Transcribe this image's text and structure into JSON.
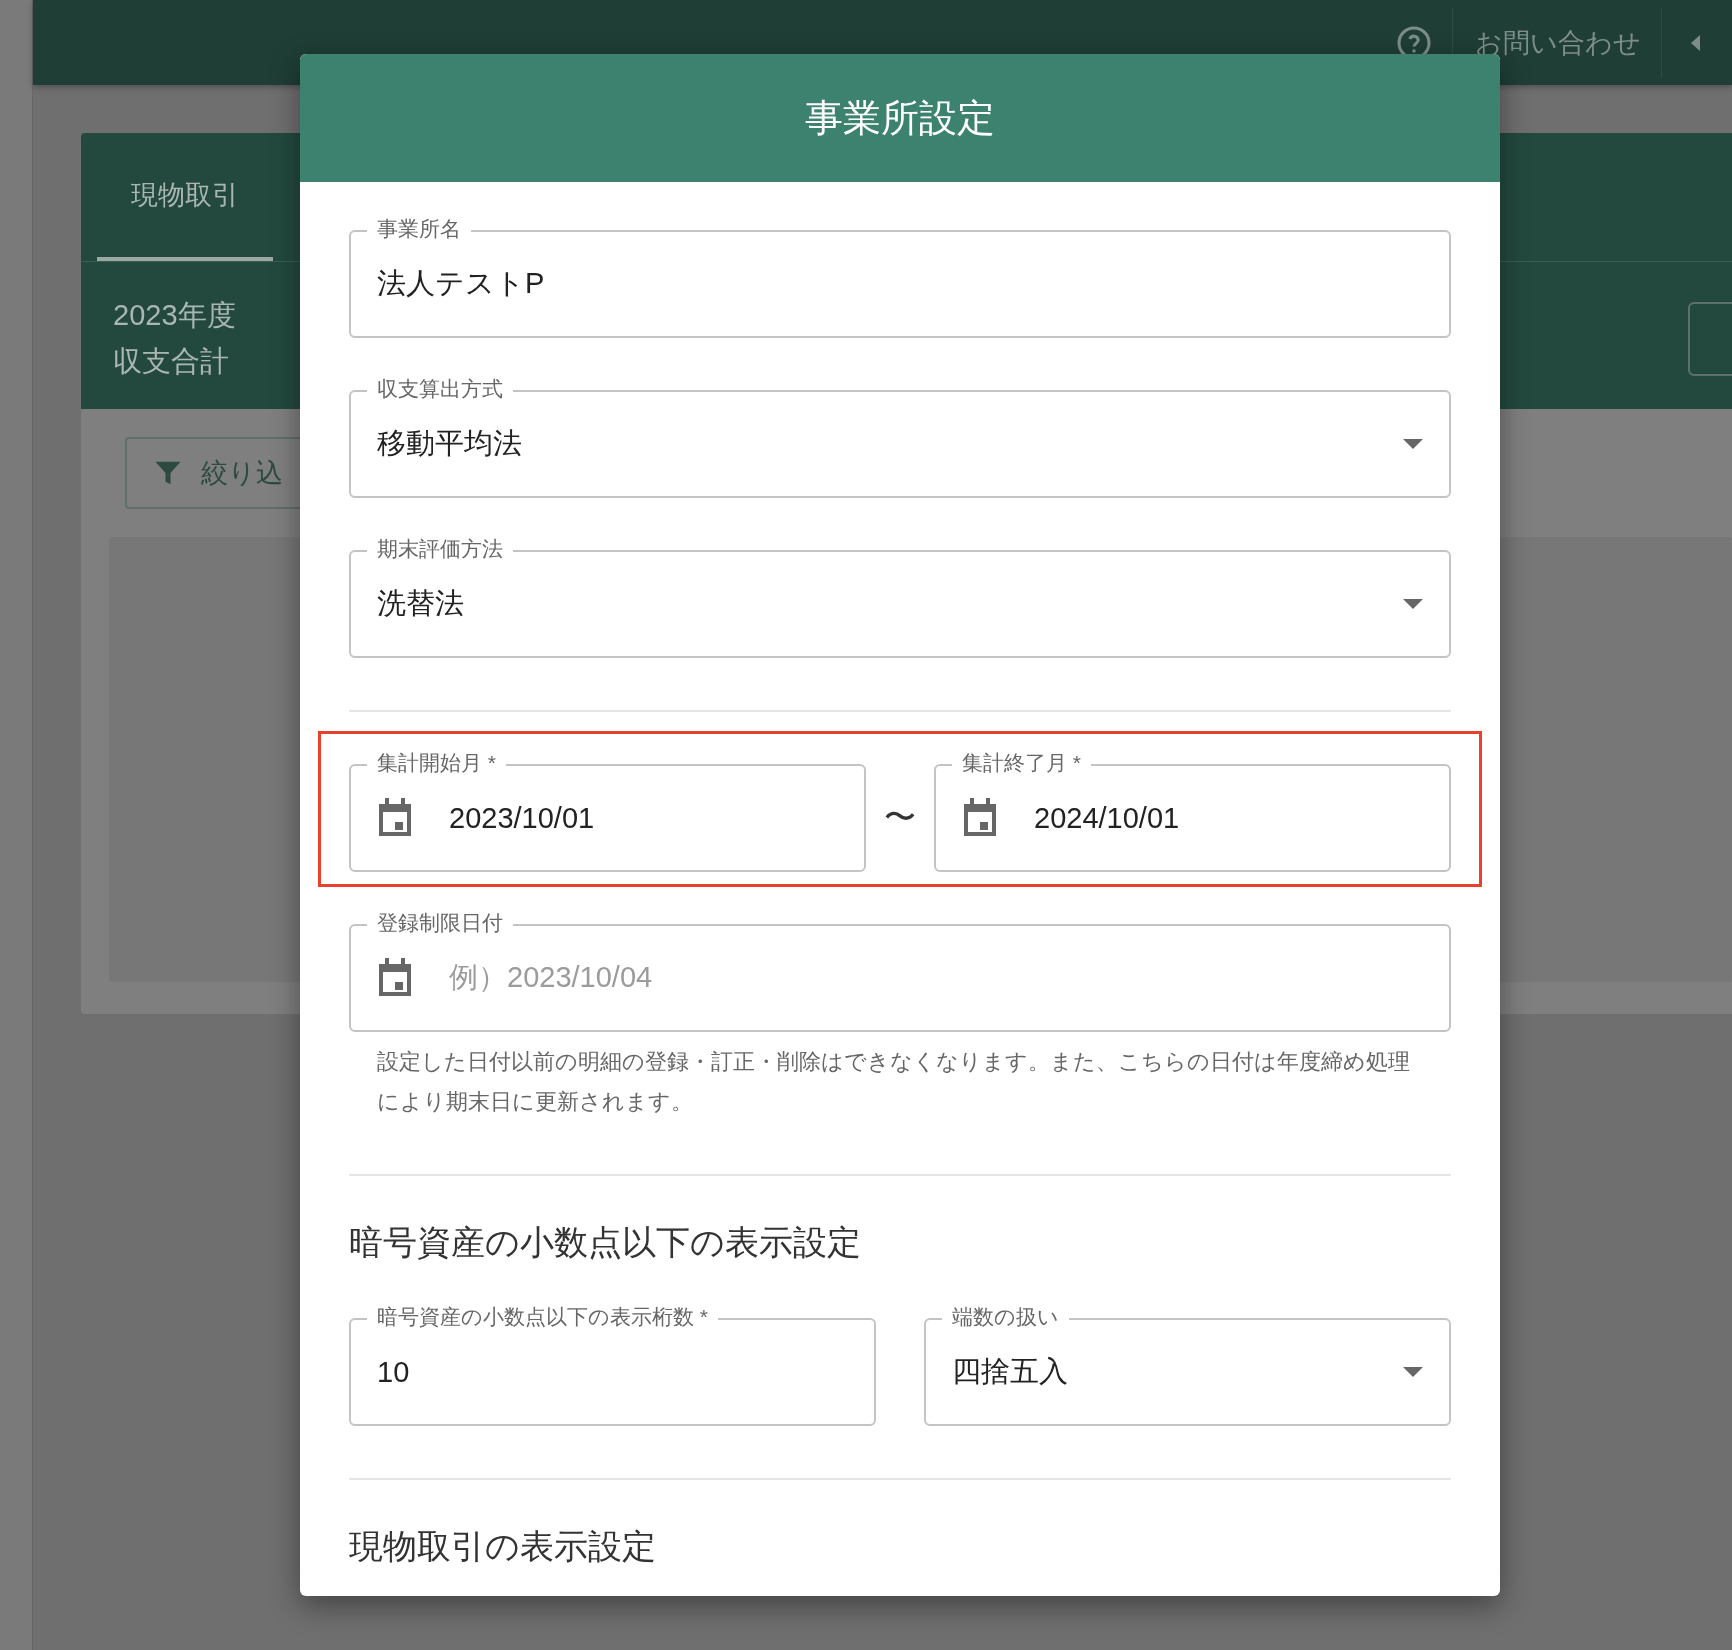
{
  "background": {
    "top_bar": {
      "contact_link": "お問い合わせ"
    },
    "card": {
      "tabs": [
        {
          "label": "現物取引",
          "selected": true
        }
      ],
      "summary_label": [
        "2023年度",
        "収支合計"
      ],
      "filter_button": "絞り込"
    }
  },
  "dialog": {
    "title": "事業所設定",
    "items": [
      {
        "kind": "text",
        "label": "事業所名",
        "value": "法人テストP"
      },
      {
        "kind": "select",
        "label": "収支算出方式",
        "value": "移動平均法"
      },
      {
        "kind": "select",
        "label": "期末評価方法",
        "value": "洗替法"
      },
      {
        "kind": "divider"
      },
      {
        "kind": "date_range",
        "highlighted": true,
        "separator": "〜",
        "fields": [
          {
            "label": "集計開始月 *",
            "value": "2023/10/01"
          },
          {
            "label": "集計終了月 *",
            "value": "2024/10/01"
          }
        ]
      },
      {
        "kind": "date",
        "label": "登録制限日付",
        "placeholder": "例）2023/10/04",
        "helper": "設定した日付以前の明細の登録・訂正・削除はできなくなります。また、こちらの日付は年度締め処理により期末日に更新されます。"
      },
      {
        "kind": "divider"
      },
      {
        "kind": "heading",
        "text": "暗号資産の小数点以下の表示設定"
      },
      {
        "kind": "row",
        "fields": [
          {
            "kind": "text",
            "label": "暗号資産の小数点以下の表示桁数 *",
            "value": "10"
          },
          {
            "kind": "select",
            "label": "端数の扱い",
            "value": "四捨五入"
          }
        ]
      },
      {
        "kind": "divider"
      },
      {
        "kind": "heading",
        "text": "現物取引の表示設定"
      }
    ]
  }
}
